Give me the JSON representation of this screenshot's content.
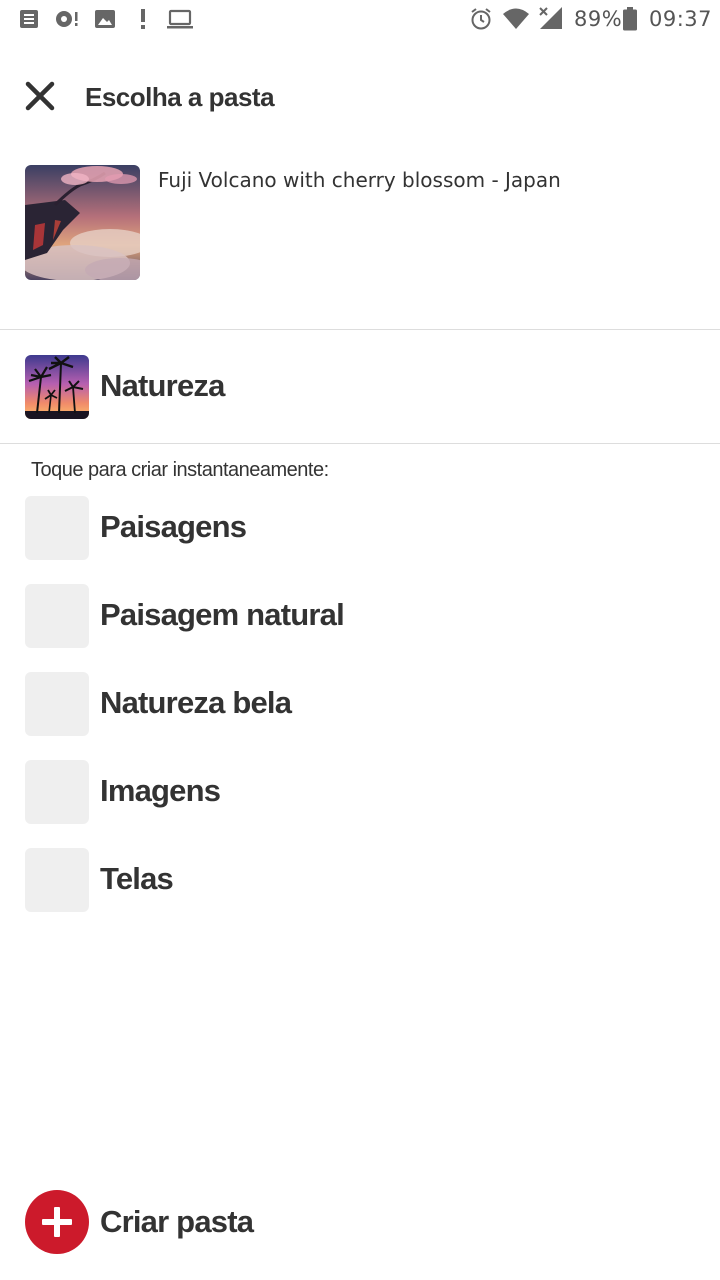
{
  "status_bar": {
    "battery": "89%",
    "time": "09:37",
    "left_icons": [
      "notes-icon",
      "sync-alert-icon",
      "image-icon",
      "alert-icon",
      "laptop-icon"
    ],
    "right_icons": [
      "alarm-icon",
      "wifi-icon",
      "cell-signal-icon",
      "battery-icon"
    ]
  },
  "header": {
    "title": "Escolha a pasta",
    "close_icon": "close-icon"
  },
  "pin": {
    "description": "Fuji Volcano with cherry blossom - Japan"
  },
  "current_board": {
    "label": "Natureza"
  },
  "suggestions": {
    "hint": "Toque para criar instantaneamente:",
    "items": [
      {
        "label": "Paisagens"
      },
      {
        "label": "Paisagem natural"
      },
      {
        "label": "Natureza bela"
      },
      {
        "label": "Imagens"
      },
      {
        "label": "Telas"
      }
    ]
  },
  "create_board": {
    "label": "Criar pasta",
    "icon": "plus-icon"
  },
  "colors": {
    "accent": "#cc1a2b",
    "text": "#333333",
    "placeholder": "#efefef",
    "divider": "#dddddd"
  }
}
